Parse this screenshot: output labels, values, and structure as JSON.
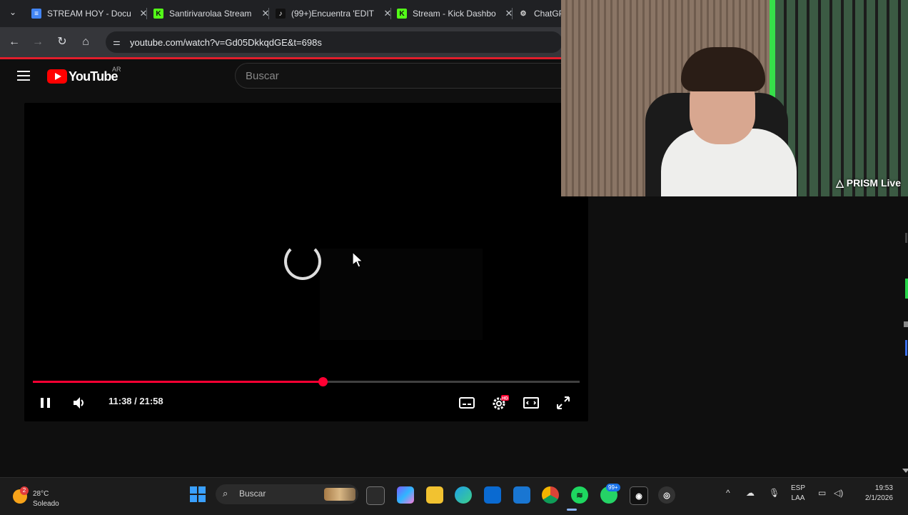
{
  "browser": {
    "tabs": [
      {
        "title": "STREAM HOY - Docu",
        "icon": "docs-icon",
        "color": "#4285f4"
      },
      {
        "title": "Santirivarolaa Stream",
        "icon": "kick-icon",
        "color": "#53fc18"
      },
      {
        "title": "(99+)Encuentra 'EDIT",
        "icon": "tiktok-icon",
        "color": "#ffffff"
      },
      {
        "title": "Stream - Kick Dashbo",
        "icon": "kick-icon",
        "color": "#53fc18"
      },
      {
        "title": "ChatGP",
        "icon": "chatgpt-icon",
        "color": "#dddddd"
      }
    ],
    "url": "youtube.com/watch?v=Gd05DkkqdGE&t=698s"
  },
  "youtube": {
    "logo_text": "YouTube",
    "country": "AR",
    "search_placeholder": "Buscar"
  },
  "player": {
    "current_time": "11:38",
    "duration": "21:58",
    "time_display": "11:38 / 21:58",
    "progress_fraction": 0.53,
    "settings_badge": "HD",
    "accent_color": "#ff0033"
  },
  "webcam": {
    "overlay_label": "PRISM Live"
  },
  "taskbar": {
    "weather_temp": "28°C",
    "weather_cond": "Soleado",
    "weather_badge": "2",
    "search_label": "Buscar",
    "whatsapp_badge": "99+",
    "lang_top": "ESP",
    "lang_bottom": "LAA",
    "time": "19:53",
    "date": "2/1/2026"
  }
}
